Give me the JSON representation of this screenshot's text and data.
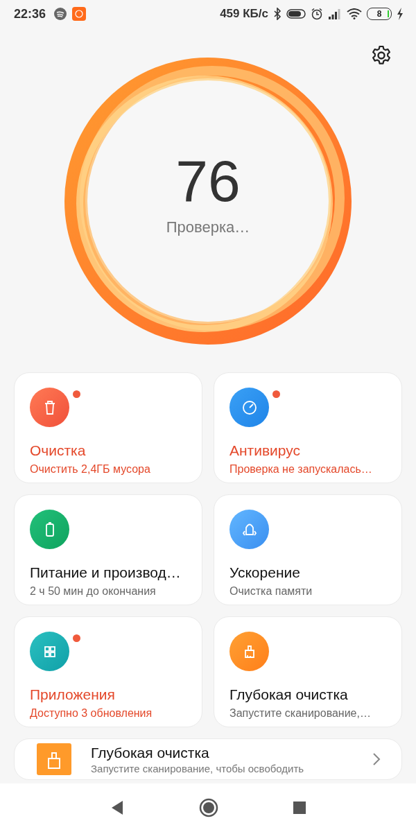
{
  "status_bar": {
    "time": "22:36",
    "speed": "459 КБ/с",
    "battery": "8"
  },
  "score": {
    "value": "76",
    "status": "Проверка…"
  },
  "cards": [
    {
      "kind": "cleaner",
      "title": "Очистка",
      "subtitle": "Очистить 2,4ГБ мусора",
      "alert": true,
      "badge": true
    },
    {
      "kind": "antivirus",
      "title": "Антивирус",
      "subtitle": "Проверка не запускалась…",
      "alert": true,
      "badge": true
    },
    {
      "kind": "battery",
      "title": "Питание и производ…",
      "subtitle": "2 ч 50 мин до окончания",
      "alert": false,
      "badge": false
    },
    {
      "kind": "boost",
      "title": "Ускорение",
      "subtitle": "Очистка памяти",
      "alert": false,
      "badge": false
    },
    {
      "kind": "apps",
      "title": "Приложения",
      "subtitle": "Доступно 3 обновления",
      "alert": true,
      "badge": true
    },
    {
      "kind": "deepclean",
      "title": "Глубокая очистка",
      "subtitle": "Запустите сканирование,…",
      "alert": false,
      "badge": false
    }
  ],
  "banner": {
    "title": "Глубокая очистка",
    "subtitle": "Запустите сканирование, чтобы освободить"
  }
}
